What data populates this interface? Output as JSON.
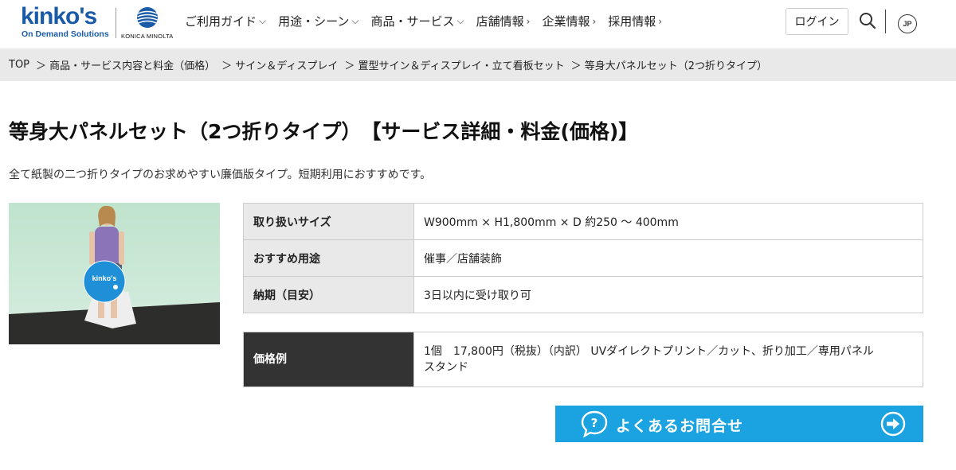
{
  "header": {
    "logo_main": "kinko's",
    "logo_sub": "On Demand Solutions",
    "partner_logo_text": "KONICA MINOLTA",
    "nav": [
      {
        "label": "ご利用ガイド",
        "chevron": "⌵"
      },
      {
        "label": "用途・シーン",
        "chevron": "⌵"
      },
      {
        "label": "商品・サービス",
        "chevron": "⌵"
      },
      {
        "label": "店舗情報",
        "chevron": "›"
      },
      {
        "label": "企業情報",
        "chevron": "›"
      },
      {
        "label": "採用情報",
        "chevron": "›"
      }
    ],
    "login_label": "ログイン",
    "lang_label": "JP"
  },
  "breadcrumb": [
    "TOP",
    "＞ 商品・サービス内容と料金（価格）",
    "＞ サイン＆ディスプレイ",
    "＞ 置型サイン＆ディスプレイ・立て看板セット",
    "＞ 等身大パネルセット（2つ折りタイプ）"
  ],
  "main": {
    "title": "等身大パネルセット（2つ折りタイプ）　【サービス詳細・料金(価格)】",
    "lead": "全て紙製の二つ折りタイプのお求めやすい廉価版タイプ。短期利用におすすめです。",
    "product_sign_text": "kinko's",
    "specs": [
      {
        "label": "取り扱いサイズ",
        "value": "W900mm × H1,800mm × D 約250 〜 400mm"
      },
      {
        "label": "おすすめ用途",
        "value": "催事／店舗装飾"
      },
      {
        "label": "納期（目安）",
        "value": "3日以内に受け取り可"
      }
    ],
    "price": {
      "label": "価格例",
      "value_line1": "1個　17,800円（税抜）（内訳） UVダイレクトプリント／カット、折り加工／専用パネル",
      "value_line2": "スタンド"
    },
    "faq_label": "よくあるお問合せ"
  },
  "colors": {
    "brand_blue": "#1a5ba8",
    "faq_blue": "#1aa3e0",
    "price_header": "#333333",
    "table_header": "#e9e9e9"
  }
}
